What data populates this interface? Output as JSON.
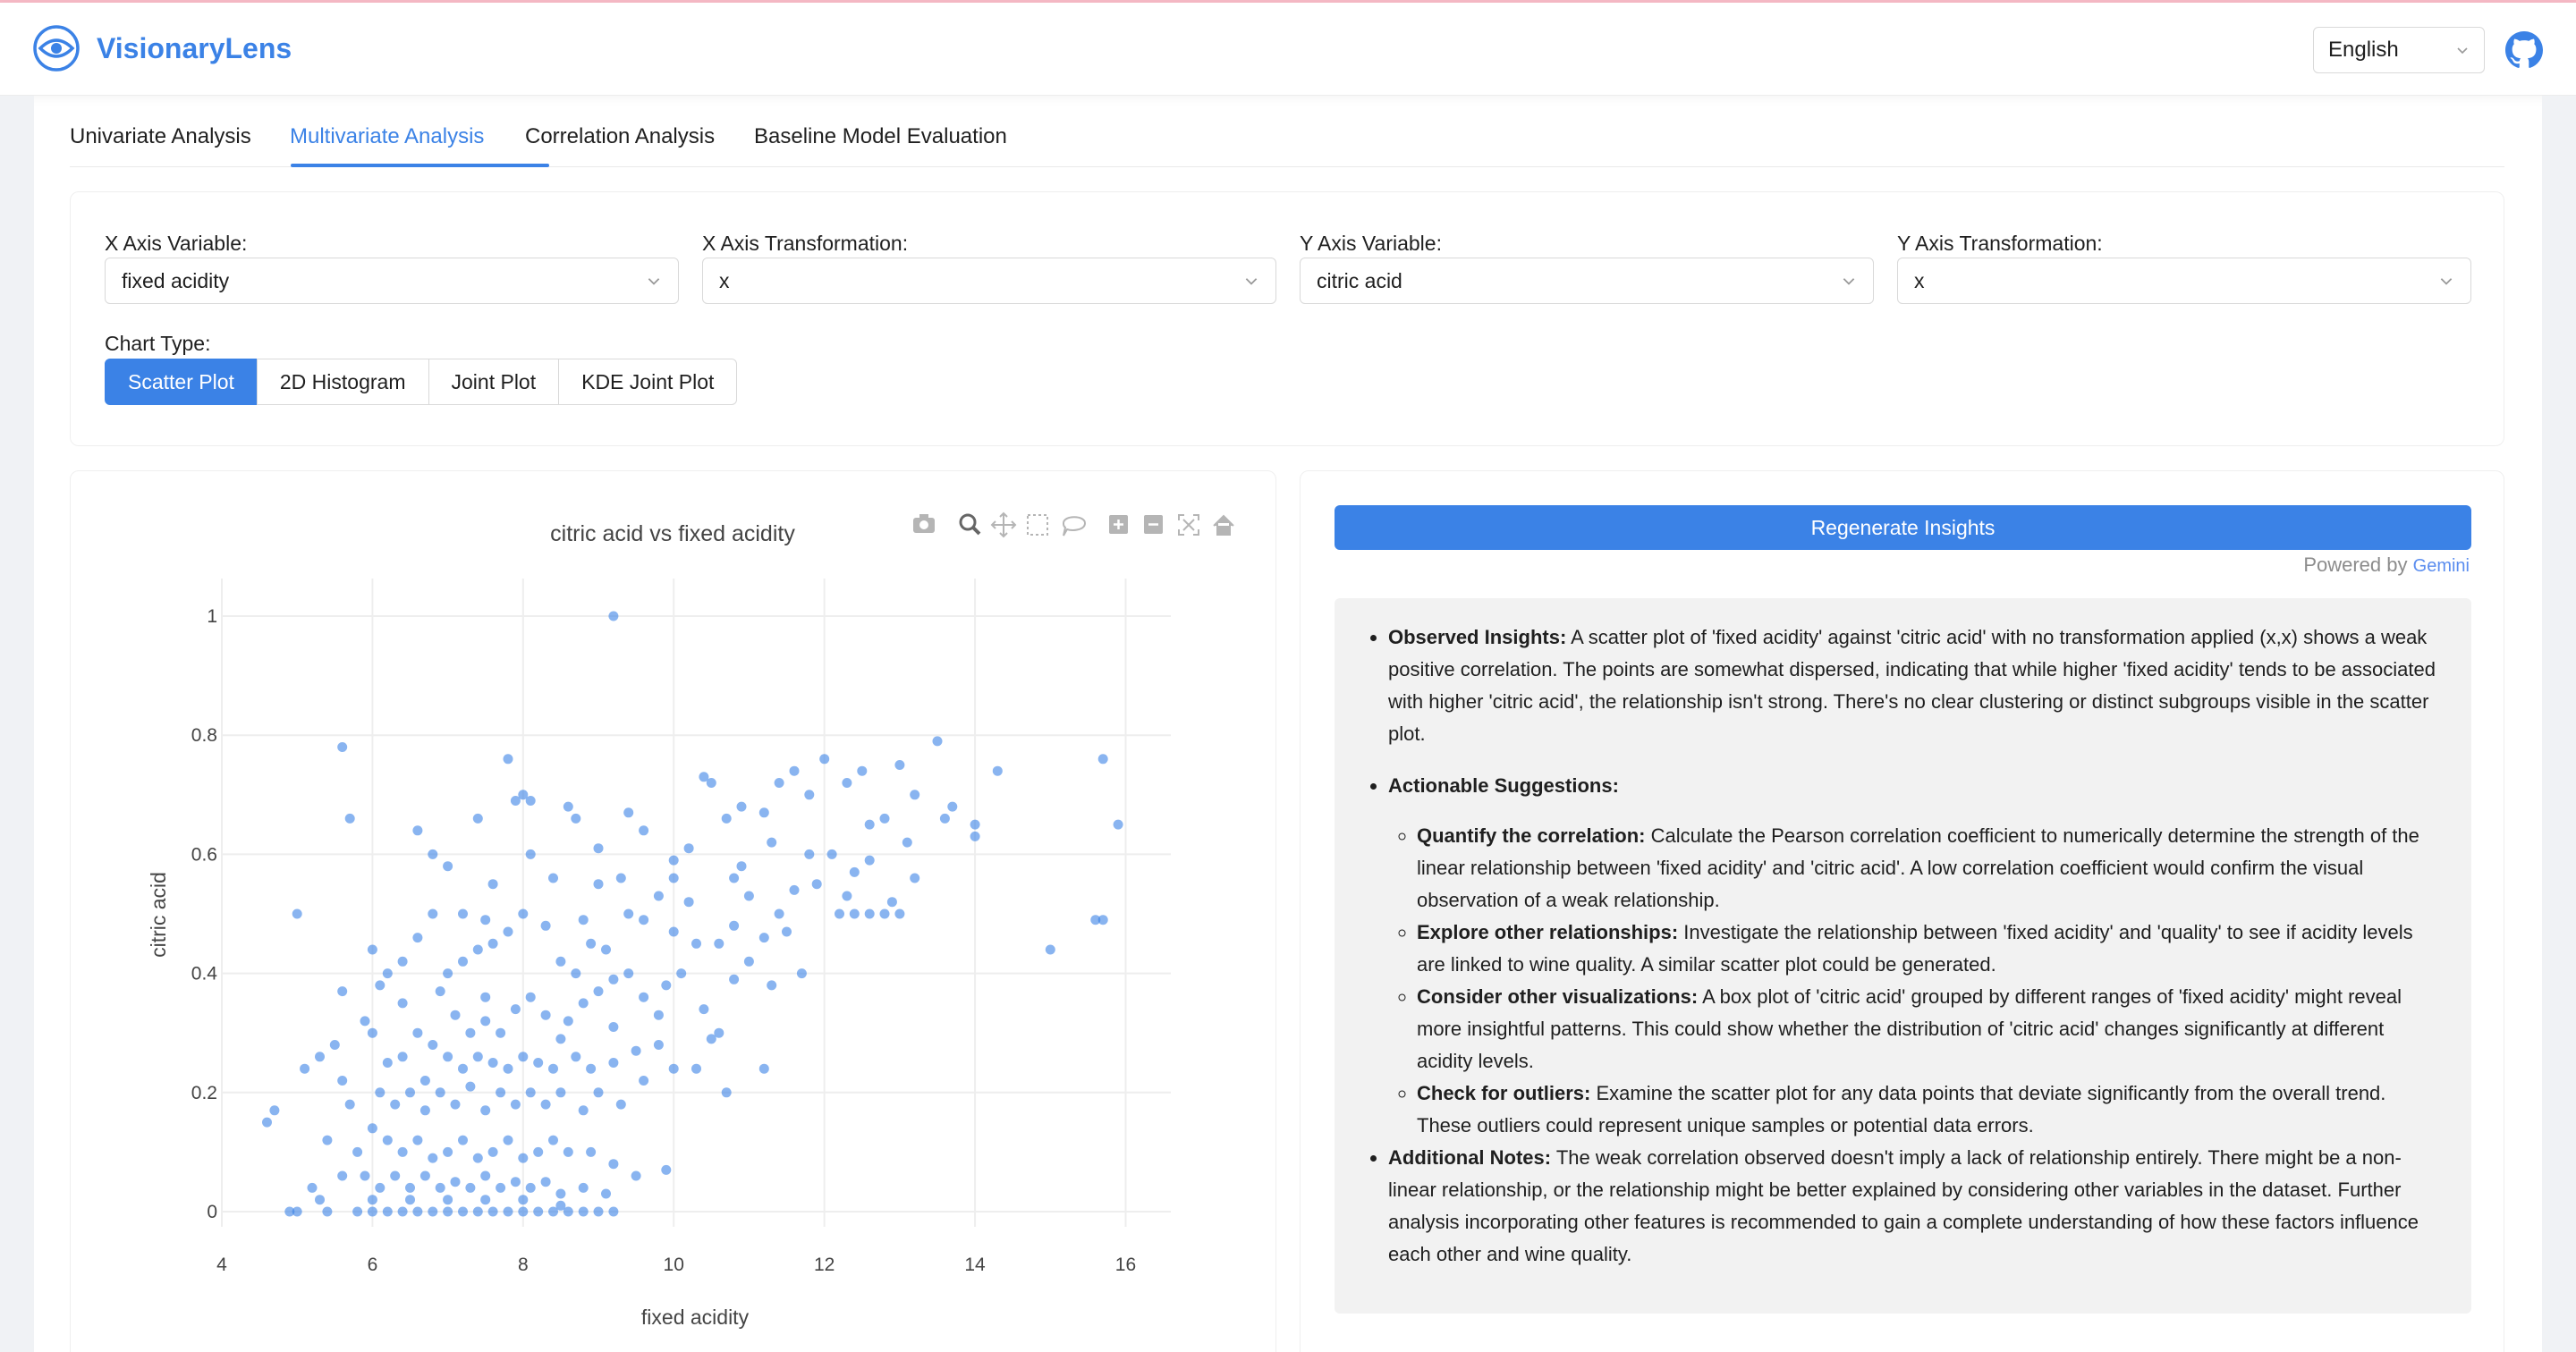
{
  "app": {
    "title": "VisionaryLens",
    "language": "English",
    "icons": {
      "logo": "eye-logo-icon",
      "github": "github-icon",
      "chevron": "chevron-down-icon"
    }
  },
  "tabs": [
    {
      "label": "Univariate Analysis",
      "active": false
    },
    {
      "label": "Multivariate Analysis",
      "active": true
    },
    {
      "label": "Correlation Analysis",
      "active": false
    },
    {
      "label": "Baseline Model Evaluation",
      "active": false
    }
  ],
  "controls": {
    "x_axis_variable": {
      "label": "X Axis Variable:",
      "value": "fixed acidity"
    },
    "x_axis_transformation": {
      "label": "X Axis Transformation:",
      "value": "x"
    },
    "y_axis_variable": {
      "label": "Y Axis Variable:",
      "value": "citric acid"
    },
    "y_axis_transformation": {
      "label": "Y Axis Transformation:",
      "value": "x"
    },
    "chart_type": {
      "label": "Chart Type:",
      "options": [
        "Scatter Plot",
        "2D Histogram",
        "Joint Plot",
        "KDE Joint Plot"
      ],
      "selected": "Scatter Plot"
    }
  },
  "chart_toolbar": [
    "camera-icon",
    "zoom-icon",
    "pan-icon",
    "box-select-icon",
    "lasso-select-icon",
    "zoom-in-icon",
    "zoom-out-icon",
    "autoscale-icon",
    "reset-axes-icon"
  ],
  "chart_data": {
    "type": "scatter",
    "title": "citric acid vs fixed acidity",
    "xlabel": "fixed acidity",
    "ylabel": "citric acid",
    "xlim": [
      4,
      16.6
    ],
    "ylim": [
      0,
      1
    ],
    "xticks": [
      4,
      6,
      8,
      10,
      12,
      14,
      16
    ],
    "yticks": [
      0,
      0.2,
      0.4,
      0.6,
      0.8,
      1
    ],
    "ytick_labels": [
      "0",
      "0.2",
      "0.4",
      "0.6",
      "0.8",
      "1"
    ],
    "grid": true,
    "marker_color": "#3b82e6",
    "points": [
      [
        9.2,
        1.0
      ],
      [
        5.6,
        0.78
      ],
      [
        5.7,
        0.66
      ],
      [
        5.0,
        0.5
      ],
      [
        5.6,
        0.37
      ],
      [
        4.6,
        0.15
      ],
      [
        4.7,
        0.17
      ],
      [
        4.9,
        0.0
      ],
      [
        5.0,
        0.0
      ],
      [
        5.2,
        0.04
      ],
      [
        5.3,
        0.02
      ],
      [
        5.4,
        0.0
      ],
      [
        5.6,
        0.06
      ],
      [
        5.8,
        0.0
      ],
      [
        5.1,
        0.24
      ],
      [
        5.3,
        0.26
      ],
      [
        5.5,
        0.28
      ],
      [
        6.0,
        0.3
      ],
      [
        6.1,
        0.38
      ],
      [
        6.2,
        0.4
      ],
      [
        6.4,
        0.35
      ],
      [
        6.6,
        0.46
      ],
      [
        6.8,
        0.5
      ],
      [
        6.8,
        0.6
      ],
      [
        6.6,
        0.64
      ],
      [
        7.0,
        0.58
      ],
      [
        7.4,
        0.66
      ],
      [
        7.8,
        0.76
      ],
      [
        7.9,
        0.69
      ],
      [
        8.0,
        0.7
      ],
      [
        8.1,
        0.69
      ],
      [
        8.6,
        0.68
      ],
      [
        8.7,
        0.66
      ],
      [
        9.0,
        0.61
      ],
      [
        9.4,
        0.67
      ],
      [
        9.6,
        0.64
      ],
      [
        10.0,
        0.59
      ],
      [
        10.2,
        0.61
      ],
      [
        10.4,
        0.73
      ],
      [
        10.5,
        0.72
      ],
      [
        10.7,
        0.66
      ],
      [
        10.9,
        0.68
      ],
      [
        11.2,
        0.67
      ],
      [
        11.4,
        0.72
      ],
      [
        11.6,
        0.74
      ],
      [
        11.8,
        0.7
      ],
      [
        12.0,
        0.76
      ],
      [
        12.3,
        0.72
      ],
      [
        12.5,
        0.74
      ],
      [
        12.6,
        0.65
      ],
      [
        12.8,
        0.66
      ],
      [
        13.0,
        0.75
      ],
      [
        13.2,
        0.7
      ],
      [
        13.5,
        0.79
      ],
      [
        13.6,
        0.66
      ],
      [
        14.0,
        0.65
      ],
      [
        14.3,
        0.74
      ],
      [
        13.7,
        0.68
      ],
      [
        14.0,
        0.63
      ],
      [
        15.0,
        0.44
      ],
      [
        15.6,
        0.49
      ],
      [
        15.7,
        0.49
      ],
      [
        15.7,
        0.76
      ],
      [
        15.9,
        0.65
      ],
      [
        12.1,
        0.6
      ],
      [
        11.9,
        0.55
      ],
      [
        12.2,
        0.5
      ],
      [
        12.4,
        0.5
      ],
      [
        12.6,
        0.5
      ],
      [
        12.8,
        0.5
      ],
      [
        13.0,
        0.5
      ],
      [
        12.9,
        0.52
      ],
      [
        13.2,
        0.56
      ],
      [
        12.4,
        0.57
      ],
      [
        11.6,
        0.54
      ],
      [
        11.4,
        0.5
      ],
      [
        11.0,
        0.53
      ],
      [
        10.8,
        0.48
      ],
      [
        10.6,
        0.45
      ],
      [
        11.5,
        0.47
      ],
      [
        11.0,
        0.42
      ],
      [
        11.7,
        0.4
      ],
      [
        11.3,
        0.38
      ],
      [
        10.8,
        0.39
      ],
      [
        10.3,
        0.45
      ],
      [
        10.0,
        0.47
      ],
      [
        9.8,
        0.53
      ],
      [
        9.6,
        0.49
      ],
      [
        9.4,
        0.5
      ],
      [
        9.1,
        0.44
      ],
      [
        8.9,
        0.45
      ],
      [
        8.7,
        0.4
      ],
      [
        8.5,
        0.42
      ],
      [
        8.3,
        0.48
      ],
      [
        8.0,
        0.5
      ],
      [
        7.8,
        0.47
      ],
      [
        7.6,
        0.45
      ],
      [
        7.4,
        0.44
      ],
      [
        7.2,
        0.42
      ],
      [
        7.0,
        0.4
      ],
      [
        6.9,
        0.37
      ],
      [
        7.1,
        0.33
      ],
      [
        7.3,
        0.3
      ],
      [
        7.5,
        0.32
      ],
      [
        7.7,
        0.3
      ],
      [
        7.9,
        0.34
      ],
      [
        8.1,
        0.36
      ],
      [
        8.3,
        0.33
      ],
      [
        8.6,
        0.32
      ],
      [
        8.8,
        0.35
      ],
      [
        9.0,
        0.37
      ],
      [
        9.2,
        0.39
      ],
      [
        9.4,
        0.4
      ],
      [
        9.6,
        0.36
      ],
      [
        9.9,
        0.38
      ],
      [
        10.1,
        0.4
      ],
      [
        10.4,
        0.34
      ],
      [
        10.6,
        0.3
      ],
      [
        9.8,
        0.28
      ],
      [
        9.5,
        0.27
      ],
      [
        9.2,
        0.25
      ],
      [
        8.9,
        0.24
      ],
      [
        8.7,
        0.26
      ],
      [
        8.4,
        0.24
      ],
      [
        8.2,
        0.25
      ],
      [
        8.0,
        0.26
      ],
      [
        7.8,
        0.24
      ],
      [
        7.6,
        0.25
      ],
      [
        7.4,
        0.26
      ],
      [
        7.2,
        0.24
      ],
      [
        7.0,
        0.26
      ],
      [
        6.8,
        0.28
      ],
      [
        6.6,
        0.3
      ],
      [
        6.4,
        0.26
      ],
      [
        6.2,
        0.25
      ],
      [
        6.1,
        0.2
      ],
      [
        6.3,
        0.18
      ],
      [
        6.5,
        0.2
      ],
      [
        6.7,
        0.17
      ],
      [
        6.9,
        0.2
      ],
      [
        7.1,
        0.18
      ],
      [
        7.3,
        0.21
      ],
      [
        7.5,
        0.17
      ],
      [
        7.7,
        0.2
      ],
      [
        7.9,
        0.18
      ],
      [
        8.1,
        0.2
      ],
      [
        8.3,
        0.18
      ],
      [
        8.5,
        0.2
      ],
      [
        8.8,
        0.17
      ],
      [
        9.0,
        0.2
      ],
      [
        9.3,
        0.18
      ],
      [
        9.6,
        0.22
      ],
      [
        10.0,
        0.24
      ],
      [
        10.3,
        0.24
      ],
      [
        10.7,
        0.2
      ],
      [
        11.2,
        0.24
      ],
      [
        6.0,
        0.14
      ],
      [
        6.2,
        0.12
      ],
      [
        6.4,
        0.1
      ],
      [
        6.6,
        0.12
      ],
      [
        6.8,
        0.09
      ],
      [
        7.0,
        0.1
      ],
      [
        7.2,
        0.12
      ],
      [
        7.4,
        0.09
      ],
      [
        7.6,
        0.1
      ],
      [
        7.8,
        0.12
      ],
      [
        8.0,
        0.09
      ],
      [
        8.2,
        0.1
      ],
      [
        8.4,
        0.12
      ],
      [
        8.6,
        0.1
      ],
      [
        8.9,
        0.1
      ],
      [
        9.2,
        0.08
      ],
      [
        9.5,
        0.06
      ],
      [
        9.9,
        0.07
      ],
      [
        5.9,
        0.06
      ],
      [
        6.1,
        0.04
      ],
      [
        6.3,
        0.06
      ],
      [
        6.5,
        0.04
      ],
      [
        6.7,
        0.06
      ],
      [
        6.9,
        0.04
      ],
      [
        7.1,
        0.05
      ],
      [
        7.3,
        0.04
      ],
      [
        7.5,
        0.06
      ],
      [
        7.7,
        0.04
      ],
      [
        7.9,
        0.05
      ],
      [
        8.1,
        0.04
      ],
      [
        8.3,
        0.05
      ],
      [
        8.5,
        0.03
      ],
      [
        8.8,
        0.04
      ],
      [
        9.1,
        0.03
      ],
      [
        6.0,
        0.0
      ],
      [
        6.2,
        0.0
      ],
      [
        6.4,
        0.0
      ],
      [
        6.6,
        0.0
      ],
      [
        6.8,
        0.0
      ],
      [
        7.0,
        0.0
      ],
      [
        7.2,
        0.0
      ],
      [
        7.4,
        0.0
      ],
      [
        7.6,
        0.0
      ],
      [
        7.8,
        0.0
      ],
      [
        8.0,
        0.0
      ],
      [
        8.2,
        0.0
      ],
      [
        8.4,
        0.0
      ],
      [
        8.6,
        0.0
      ],
      [
        8.8,
        0.0
      ],
      [
        9.0,
        0.0
      ],
      [
        9.2,
        0.0
      ],
      [
        6.0,
        0.02
      ],
      [
        6.5,
        0.02
      ],
      [
        7.0,
        0.02
      ],
      [
        7.5,
        0.02
      ],
      [
        8.0,
        0.02
      ],
      [
        8.5,
        0.01
      ],
      [
        6.7,
        0.22
      ],
      [
        7.5,
        0.36
      ],
      [
        8.5,
        0.29
      ],
      [
        9.2,
        0.31
      ],
      [
        9.8,
        0.33
      ],
      [
        10.2,
        0.52
      ],
      [
        10.8,
        0.56
      ],
      [
        11.8,
        0.6
      ],
      [
        12.3,
        0.53
      ],
      [
        6.4,
        0.42
      ],
      [
        6.0,
        0.44
      ],
      [
        5.9,
        0.32
      ],
      [
        5.6,
        0.22
      ],
      [
        5.4,
        0.12
      ],
      [
        5.8,
        0.1
      ],
      [
        5.7,
        0.18
      ],
      [
        10.5,
        0.29
      ],
      [
        11.2,
        0.46
      ],
      [
        12.6,
        0.59
      ],
      [
        13.1,
        0.62
      ],
      [
        9.0,
        0.55
      ],
      [
        8.4,
        0.56
      ],
      [
        8.1,
        0.6
      ],
      [
        7.6,
        0.55
      ],
      [
        7.2,
        0.5
      ],
      [
        7.5,
        0.49
      ],
      [
        8.8,
        0.49
      ],
      [
        9.3,
        0.56
      ],
      [
        10.0,
        0.56
      ],
      [
        10.9,
        0.58
      ],
      [
        11.3,
        0.62
      ]
    ]
  },
  "insights": {
    "regenerate_label": "Regenerate Insights",
    "powered_by": "Powered by",
    "powered_brand": "Gemini",
    "observed_title": "Observed Insights:",
    "observed_text": " A scatter plot of 'fixed acidity' against 'citric acid' with no transformation applied (x,x) shows a weak positive correlation. The points are somewhat dispersed, indicating that while higher 'fixed acidity' tends to be associated with higher 'citric acid', the relationship isn't strong. There's no clear clustering or distinct subgroups visible in the scatter plot.",
    "actionable_title": "Actionable Suggestions:",
    "suggestions": [
      {
        "title": "Quantify the correlation:",
        "text": " Calculate the Pearson correlation coefficient to numerically determine the strength of the linear relationship between 'fixed acidity' and 'citric acid'. A low correlation coefficient would confirm the visual observation of a weak relationship."
      },
      {
        "title": "Explore other relationships:",
        "text": " Investigate the relationship between 'fixed acidity' and 'quality' to see if acidity levels are linked to wine quality. A similar scatter plot could be generated."
      },
      {
        "title": "Consider other visualizations:",
        "text": " A box plot of 'citric acid' grouped by different ranges of 'fixed acidity' might reveal more insightful patterns. This could show whether the distribution of 'citric acid' changes significantly at different acidity levels."
      },
      {
        "title": "Check for outliers:",
        "text": " Examine the scatter plot for any data points that deviate significantly from the overall trend. These outliers could represent unique samples or potential data errors."
      }
    ],
    "notes_title": "Additional Notes:",
    "notes_text": " The weak correlation observed doesn't imply a lack of relationship entirely. There might be a non-linear relationship, or the relationship might be better explained by considering other variables in the dataset. Further analysis incorporating other features is recommended to gain a complete understanding of how these factors influence each other and wine quality."
  }
}
